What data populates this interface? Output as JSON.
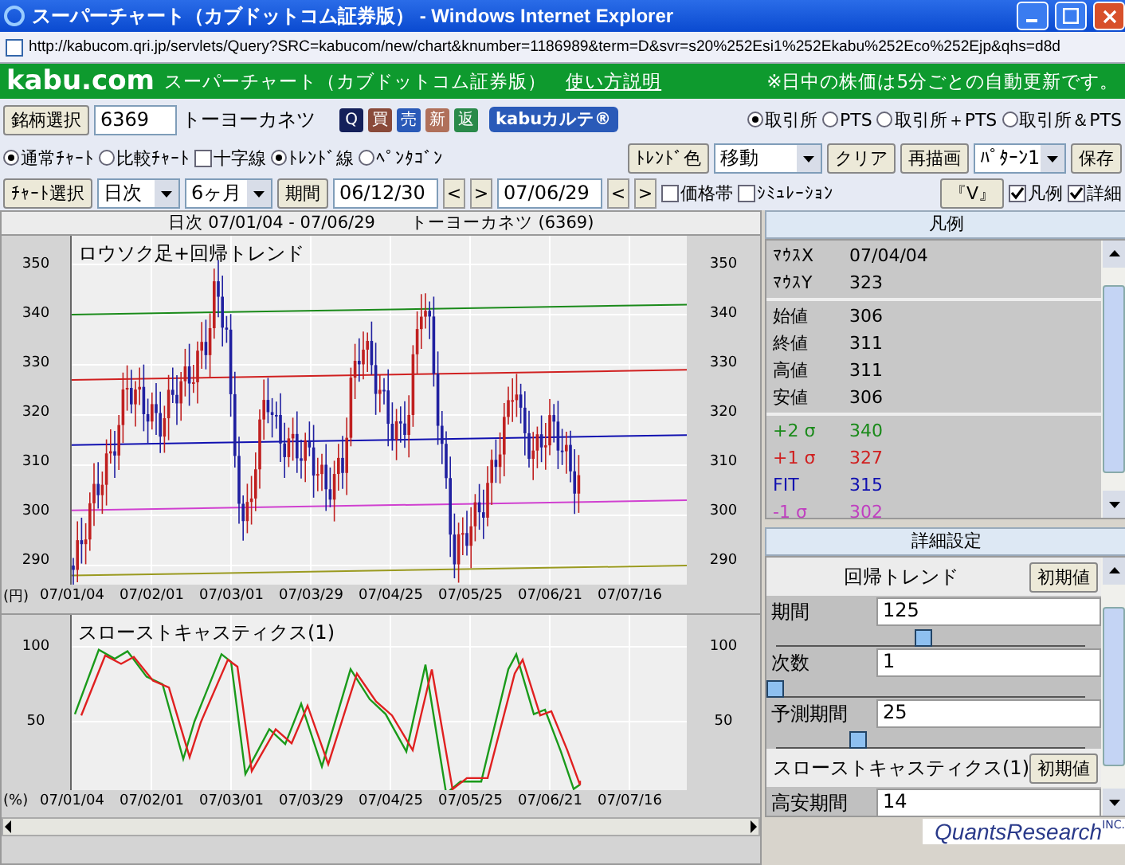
{
  "window": {
    "title": "スーパーチャート（カブドットコム証券版） - Windows Internet Explorer",
    "url": "http://kabucom.qri.jp/servlets/Query?SRC=kabucom/new/chart&knumber=1186989&term=D&svr=s20%252Esi1%252Ekabu%252Eco%252Ejp&qhs=d8d"
  },
  "header": {
    "logo": "kabu.com",
    "title": "スーパーチャート（カブドットコム証券版）",
    "help_link": "使い方説明",
    "notice": "※日中の株価は5分ごとの自動更新です。"
  },
  "stock_bar": {
    "select_button": "銘柄選択",
    "code": "6369",
    "name": "トーヨーカネツ",
    "quick_buttons": [
      {
        "label": "Q",
        "color": "#14205a"
      },
      {
        "label": "買",
        "color": "#8a4a3a"
      },
      {
        "label": "売",
        "color": "#2a5ab8"
      },
      {
        "label": "新",
        "color": "#b0705a"
      },
      {
        "label": "返",
        "color": "#2a8a4a"
      }
    ],
    "karte": "kabuカルテ®",
    "markets": [
      {
        "label": "取引所",
        "selected": true
      },
      {
        "label": "PTS",
        "selected": false
      },
      {
        "label": "取引所＋PTS",
        "selected": false
      },
      {
        "label": "取引所＆PTS",
        "selected": false
      }
    ]
  },
  "options_bar": {
    "chart_modes": [
      {
        "label": "通常ﾁｬｰﾄ",
        "selected": true
      },
      {
        "label": "比較ﾁｬｰﾄ",
        "selected": false
      }
    ],
    "crosshair": {
      "label": "十字線",
      "checked": false
    },
    "line_modes": [
      {
        "label": "ﾄﾚﾝﾄﾞ線",
        "selected": true
      },
      {
        "label": "ﾍﾟﾝﾀｺﾞﾝ",
        "selected": false
      }
    ],
    "trend_color_button": "ﾄﾚﾝﾄﾞ色",
    "trend_select": "移動",
    "clear_button": "クリア",
    "redraw_button": "再描画",
    "pattern_select": "ﾊﾟﾀｰﾝ1",
    "save_button": "保存"
  },
  "period_bar": {
    "chart_select_button": "ﾁｬｰﾄ選択",
    "interval_select": "日次",
    "span_select": "6ヶ月",
    "period_button": "期間",
    "start_date": "06/12/30",
    "start_steps": [
      "<",
      ">"
    ],
    "end_date": "07/06/29",
    "end_steps": [
      "<",
      ">"
    ],
    "checkboxes": [
      {
        "label": "価格帯",
        "checked": false
      },
      {
        "label": "ｼﾐｭﾚｰｼｮﾝ",
        "checked": false
      }
    ],
    "v_button": "『V』",
    "toggles": [
      {
        "label": "凡例",
        "checked": true
      },
      {
        "label": "詳細",
        "checked": true
      }
    ]
  },
  "charts": {
    "header": "日次 07/01/04 - 07/06/29　　トーヨーカネツ (6369)",
    "price": {
      "title": "ロウソク足+回帰トレンド",
      "left_ticks": [
        "350",
        "340",
        "330",
        "320",
        "310",
        "300",
        "290"
      ],
      "right_ticks": [
        "350",
        "340",
        "330",
        "320",
        "310",
        "300",
        "290"
      ],
      "unit": "(円)",
      "xticks": [
        "07/01/04",
        "07/02/01",
        "07/03/01",
        "07/03/29",
        "07/04/25",
        "07/05/25",
        "07/06/21",
        "07/07/16"
      ]
    },
    "stochastic": {
      "title": "スローストキャスティクス(1)",
      "left_ticks": [
        "100",
        "50"
      ],
      "right_ticks": [
        "100",
        "50"
      ],
      "unit": "(%)",
      "xticks": [
        "07/01/04",
        "07/02/01",
        "07/03/01",
        "07/03/29",
        "07/04/25",
        "07/05/25",
        "07/06/21",
        "07/07/16"
      ]
    }
  },
  "legend": {
    "title": "凡例",
    "sections": [
      {
        "rows": [
          {
            "label": "ﾏｳｽX",
            "value": "07/04/04",
            "color": "#000000"
          },
          {
            "label": "ﾏｳｽY",
            "value": "323",
            "color": "#000000"
          }
        ]
      },
      {
        "rows": [
          {
            "label": "始値",
            "value": "306",
            "color": "#000000"
          },
          {
            "label": "終値",
            "value": "311",
            "color": "#000000"
          },
          {
            "label": "高値",
            "value": "311",
            "color": "#000000"
          },
          {
            "label": "安値",
            "value": "306",
            "color": "#000000"
          }
        ]
      },
      {
        "rows": [
          {
            "label": "+2 σ",
            "value": "340",
            "color": "#1a8a1a"
          },
          {
            "label": "+1 σ",
            "value": "327",
            "color": "#d02020"
          },
          {
            "label": "FIT",
            "value": "315",
            "color": "#1010b0"
          },
          {
            "label": "-1 σ",
            "value": "302",
            "color": "#c040c0"
          }
        ]
      }
    ]
  },
  "settings": {
    "title": "詳細設定",
    "sections": [
      {
        "title": "回帰トレンド",
        "reset": "初期値",
        "params": [
          {
            "label": "期間",
            "value": "125",
            "level": 0.48
          },
          {
            "label": "次数",
            "value": "1",
            "level": 0
          },
          {
            "label": "予測期間",
            "value": "25",
            "level": 0.27
          }
        ]
      },
      {
        "title": "スローストキャスティクス(1)",
        "reset": "初期値",
        "params": [
          {
            "label": "高安期間",
            "value": "14"
          }
        ]
      }
    ]
  },
  "footer": {
    "brand": "QuantsResearch",
    "suffix": "INC."
  }
}
